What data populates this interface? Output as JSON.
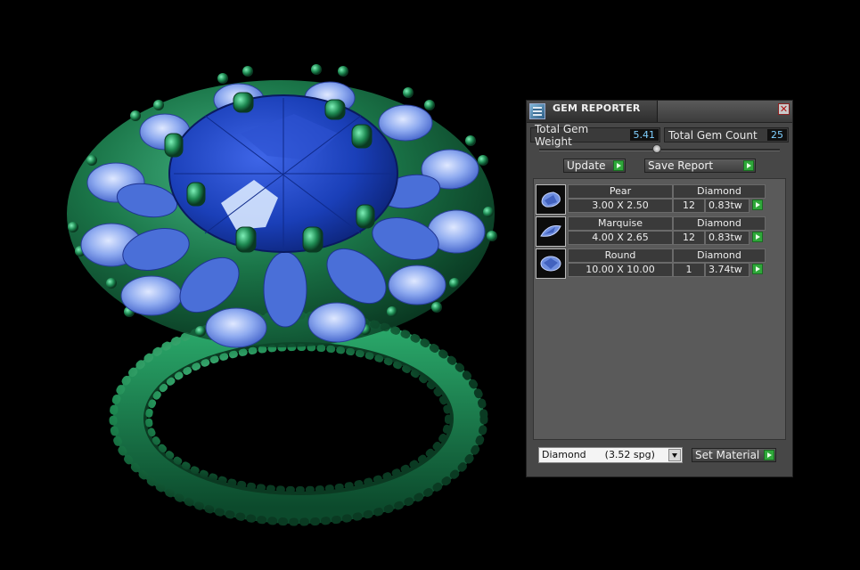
{
  "viewport": {
    "background": "#000000",
    "metal_color": "#1f8a55",
    "center_stone_color": "#1a3fb8",
    "accent_stone_color": "#6f93ea"
  },
  "panel": {
    "title": "GEM REPORTER",
    "icon": "gem-reporter-app-icon",
    "close_glyph": "✕",
    "total_weight_label": "Total Gem Weight",
    "total_weight_value": "5.41",
    "total_count_label": "Total Gem Count",
    "total_count_value": "25",
    "update_label": "Update",
    "save_report_label": "Save Report",
    "gems": [
      {
        "shape": "Pear",
        "size": "3.00 X 2.50",
        "material": "Diamond",
        "count": "12",
        "weight": "0.83tw",
        "icon": "pear-gem-icon"
      },
      {
        "shape": "Marquise",
        "size": "4.00 X 2.65",
        "material": "Diamond",
        "count": "12",
        "weight": "0.83tw",
        "icon": "marquise-gem-icon"
      },
      {
        "shape": "Round",
        "size": "10.00 X 10.00",
        "material": "Diamond",
        "count": "1",
        "weight": "3.74tw",
        "icon": "round-gem-icon"
      }
    ],
    "material_select_value": "Diamond      (3.52 spg)",
    "set_material_label": "Set Material",
    "colors": {
      "accent_green": "#2fa83a",
      "value_text": "#7fd0ff",
      "panel_bg": "#474747"
    }
  }
}
